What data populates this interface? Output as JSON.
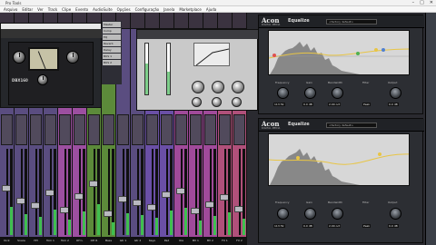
{
  "window": {
    "title": "Pro Tools"
  },
  "menu": [
    "Arquivo",
    "Editar",
    "Ver",
    "Track",
    "Clipe",
    "Evento",
    "AudioSuite",
    "Opções",
    "Configuração",
    "Janela",
    "Marketplace",
    "Ajuda"
  ],
  "window_controls": [
    "–",
    "□",
    "✕"
  ],
  "comp_plugin": {
    "brand": "DBX160"
  },
  "inserts": [
    "Master",
    "Comp",
    "EQ",
    "Reverb",
    "Delay",
    "BUS 1",
    "BUS 2"
  ],
  "channel_strip": {
    "title": "Channel Strip"
  },
  "acon_top": {
    "logo": "Acon",
    "logo_sub": "DIGITAL MEDIA",
    "plugin_name": "Equalize",
    "preset": "<factory default>",
    "labels": [
      "Frequency",
      "Gain",
      "Bandwidth",
      "Filter",
      "Output"
    ],
    "values": [
      "113 Hz",
      "0.0 dB",
      "2.00 oct",
      "Peak",
      "0.0 dB"
    ]
  },
  "acon_bottom": {
    "logo": "Acon",
    "logo_sub": "DIGITAL MEDIA",
    "plugin_name": "Equalize",
    "preset": "<factory default>",
    "labels": [
      "Frequency",
      "Gain",
      "Bandwidth",
      "Filter",
      "Output"
    ],
    "values": [
      "113 Hz",
      "0.0 dB",
      "2.00 oct",
      "Peak",
      "0.0 dB"
    ]
  },
  "mixer": {
    "tracks": [
      {
        "name": "Kick",
        "color": "#5a4d80",
        "level": 0.55
      },
      {
        "name": "Snare",
        "color": "#5a4d80",
        "level": 0.4
      },
      {
        "name": "HH",
        "color": "#5a4d80",
        "level": 0.35
      },
      {
        "name": "Tom 1",
        "color": "#5a4d80",
        "level": 0.5
      },
      {
        "name": "Tom 2",
        "color": "#9c4fa0",
        "level": 0.3
      },
      {
        "name": "OH L",
        "color": "#9c4fa0",
        "level": 0.45
      },
      {
        "name": "OH R",
        "color": "#5c8a3a",
        "level": 0.6
      },
      {
        "name": "Bass",
        "color": "#5c8a3a",
        "level": 0.25
      },
      {
        "name": "Gtr 1",
        "color": "#5a4d80",
        "level": 0.42
      },
      {
        "name": "Gtr 2",
        "color": "#5a4d80",
        "level": 0.38
      },
      {
        "name": "Keys",
        "color": "#6a4fa6",
        "level": 0.33
      },
      {
        "name": "Pad",
        "color": "#6a4fa6",
        "level": 0.47
      },
      {
        "name": "Vox",
        "color": "#a04a9a",
        "level": 0.52
      },
      {
        "name": "BV 1",
        "color": "#a04a9a",
        "level": 0.28
      },
      {
        "name": "BV 2",
        "color": "#a04a9a",
        "level": 0.36
      },
      {
        "name": "FX 1",
        "color": "#b0507a",
        "level": 0.44
      },
      {
        "name": "FX 2",
        "color": "#b0507a",
        "level": 0.31
      },
      {
        "name": "Rev",
        "color": "#c04a86",
        "level": 0.49
      }
    ]
  }
}
